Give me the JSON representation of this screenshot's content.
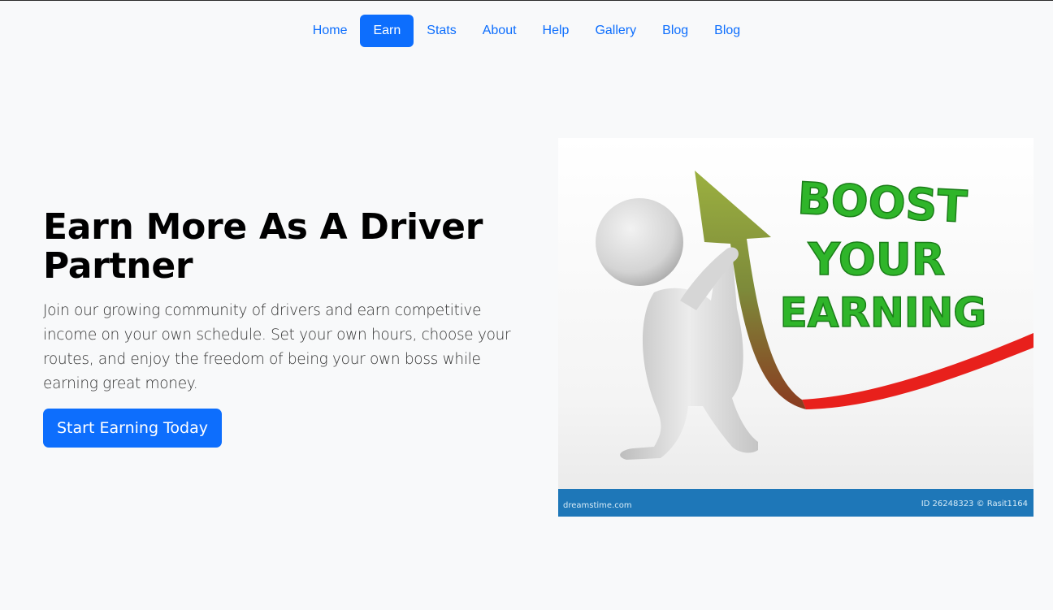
{
  "nav": {
    "items": [
      {
        "label": "Home",
        "active": false
      },
      {
        "label": "Earn",
        "active": true
      },
      {
        "label": "Stats",
        "active": false
      },
      {
        "label": "About",
        "active": false
      },
      {
        "label": "Help",
        "active": false
      },
      {
        "label": "Gallery",
        "active": false
      },
      {
        "label": "Blog",
        "active": false
      },
      {
        "label": "Blog",
        "active": false
      }
    ]
  },
  "hero": {
    "title": "Earn More As A Driver Partner",
    "description": "Join our growing community of drivers and earn competitive income on your own schedule. Set your own hours, choose your routes, and enjoy the freedom of being your own boss while earning great money.",
    "cta_label": "Start Earning Today"
  },
  "image": {
    "boost_lines": [
      "BOOST",
      "YOUR",
      "EARNING"
    ],
    "footer_left": "dreamstime.com",
    "footer_right": "ID 26248323 © Rasit1164"
  },
  "colors": {
    "accent": "#0d6efd",
    "background": "#f8f9fa",
    "boost_green": "#2fb52a",
    "arrow_red": "#e8201c",
    "image_footer": "#1e77b8"
  }
}
